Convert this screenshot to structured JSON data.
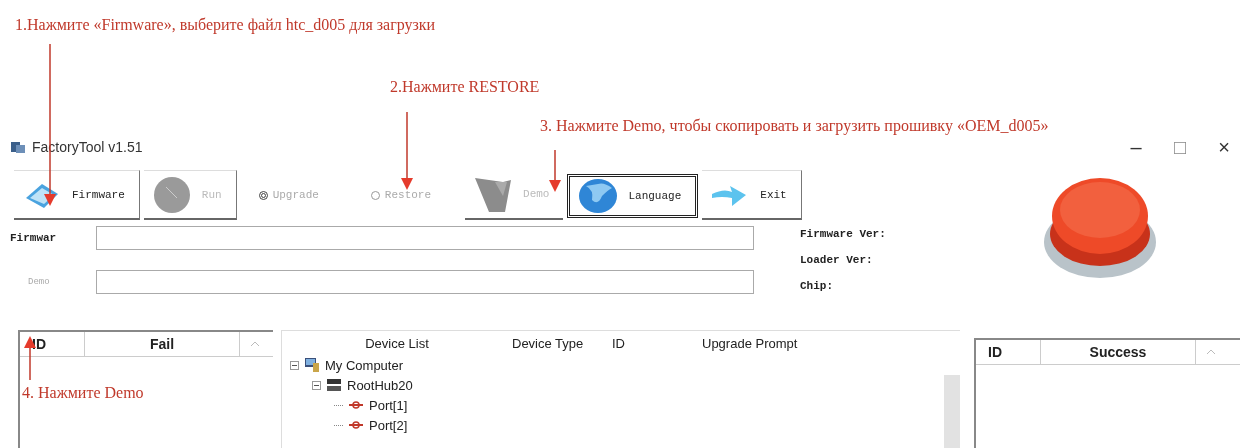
{
  "annotations": [
    {
      "text": "1.Нажмите «Firmware», выберите файл htc_d005 для загрузки"
    },
    {
      "text": "2.Нажмите RESTORE"
    },
    {
      "text": "3. Нажмите Demo, чтобы скопировать и загрузить прошивку «OEM_d005»"
    },
    {
      "text": "4. Нажмите Demo"
    }
  ],
  "window": {
    "title": "FactoryTool v1.51",
    "controls": [
      "–",
      "□",
      "×"
    ]
  },
  "toolbar": [
    {
      "kind": "button",
      "label": "Firmware",
      "disabled": false,
      "framed": false
    },
    {
      "kind": "button",
      "label": "Run",
      "disabled": true,
      "framed": false
    },
    {
      "kind": "radio",
      "label": "Upgrade",
      "selected": true,
      "disabled": true
    },
    {
      "kind": "radio",
      "label": "Restore",
      "selected": false,
      "disabled": true
    },
    {
      "kind": "button",
      "label": "Demo",
      "disabled": true,
      "framed": false
    },
    {
      "kind": "button",
      "label": "Language",
      "disabled": false,
      "framed": true
    },
    {
      "kind": "button",
      "label": "Exit",
      "disabled": false,
      "framed": false
    }
  ],
  "fields": [
    {
      "label": "Firmwar",
      "disabled": false
    },
    {
      "label": "Demo",
      "disabled": true
    }
  ],
  "info": [
    "Firmware Ver:",
    "Loader Ver:",
    "Chip:"
  ],
  "fail_table": {
    "columns": [
      "ID",
      "Fail"
    ]
  },
  "device_table": {
    "columns": [
      "Device List",
      "Device Type",
      "ID",
      "Upgrade Prompt"
    ],
    "tree": [
      {
        "label": "My Computer",
        "expanded": true,
        "children": [
          {
            "label": "RootHub20",
            "expanded": true,
            "children": [
              {
                "label": "Port[1]"
              },
              {
                "label": "Port[2]"
              }
            ]
          }
        ]
      }
    ]
  },
  "success_table": {
    "columns": [
      "ID",
      "Success"
    ]
  }
}
